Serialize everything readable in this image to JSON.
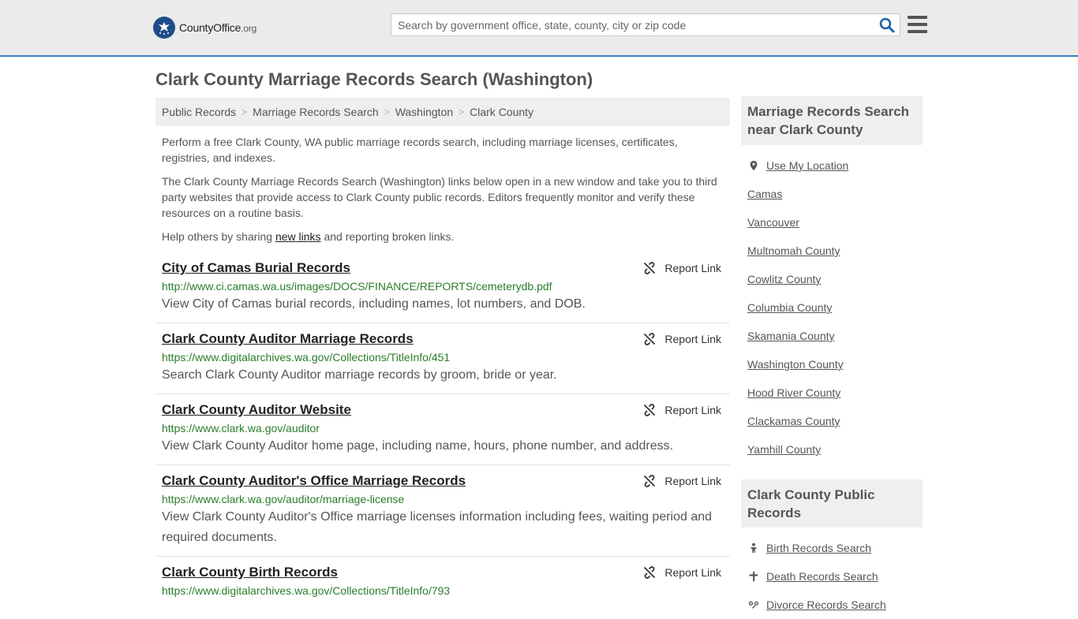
{
  "header": {
    "logo_brand": "CountyOffice",
    "logo_tld": ".org",
    "search_placeholder": "Search by government office, state, county, city or zip code"
  },
  "page": {
    "title": "Clark County Marriage Records Search (Washington)"
  },
  "breadcrumb": [
    "Public Records",
    "Marriage Records Search",
    "Washington",
    "Clark County"
  ],
  "intro": {
    "p1": "Perform a free Clark County, WA public marriage records search, including marriage licenses, certificates, registries, and indexes.",
    "p2": "The Clark County Marriage Records Search (Washington) links below open in a new window and take you to third party websites that provide access to Clark County public records. Editors frequently monitor and verify these resources on a routine basis.",
    "p3_before": "Help others by sharing ",
    "p3_link": "new links",
    "p3_after": " and reporting broken links."
  },
  "report_label": "Report Link",
  "records": [
    {
      "title": "City of Camas Burial Records",
      "url": "http://www.ci.camas.wa.us/images/DOCS/FINANCE/REPORTS/cemeterydb.pdf",
      "desc": "View City of Camas burial records, including names, lot numbers, and DOB."
    },
    {
      "title": "Clark County Auditor Marriage Records",
      "url": "https://www.digitalarchives.wa.gov/Collections/TitleInfo/451",
      "desc": "Search Clark County Auditor marriage records by groom, bride or year."
    },
    {
      "title": "Clark County Auditor Website",
      "url": "https://www.clark.wa.gov/auditor",
      "desc": "View Clark County Auditor home page, including name, hours, phone number, and address."
    },
    {
      "title": "Clark County Auditor's Office Marriage Records",
      "url": "https://www.clark.wa.gov/auditor/marriage-license",
      "desc": "View Clark County Auditor's Office marriage licenses information including fees, waiting period and required documents."
    },
    {
      "title": "Clark County Birth Records",
      "url": "https://www.digitalarchives.wa.gov/Collections/TitleInfo/793",
      "desc": ""
    }
  ],
  "sidebar": {
    "nearby_title": "Marriage Records Search near Clark County",
    "use_location": "Use My Location",
    "nearby": [
      "Camas",
      "Vancouver",
      "Multnomah County",
      "Cowlitz County",
      "Columbia County",
      "Skamania County",
      "Washington County",
      "Hood River County",
      "Clackamas County",
      "Yamhill County"
    ],
    "public_title": "Clark County Public Records",
    "public": [
      {
        "label": "Birth Records Search",
        "icon": "baby-icon"
      },
      {
        "label": "Death Records Search",
        "icon": "cross-icon"
      },
      {
        "label": "Divorce Records Search",
        "icon": "divorce-icon"
      }
    ]
  },
  "colors": {
    "accent_border": "#3d7bbf",
    "logo_blue": "#1f4d8a",
    "url_green": "#2a7d2a",
    "search_icon_blue": "#1f5fa8"
  }
}
